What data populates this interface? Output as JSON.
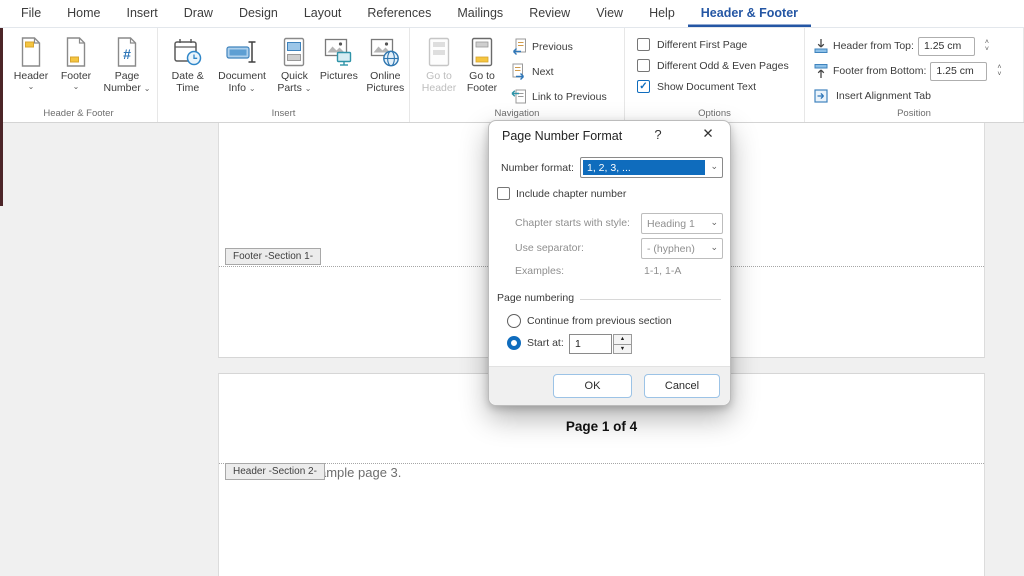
{
  "icons": {
    "close": "✕",
    "help": "?",
    "chevron_down": "⌄",
    "caret_up": "˄",
    "caret_down": "˅",
    "spin_up": "▲",
    "spin_down": "▼",
    "check": "✓"
  },
  "menu": {
    "tabs": [
      "File",
      "Home",
      "Insert",
      "Draw",
      "Design",
      "Layout",
      "References",
      "Mailings",
      "Review",
      "View",
      "Help",
      "Header & Footer"
    ],
    "active_tab": "Header & Footer"
  },
  "ribbon": {
    "header_footer_group": {
      "label": "Header & Footer",
      "header_button": "Header",
      "footer_button": "Footer",
      "page_number_button": "Page Number"
    },
    "insert_group": {
      "label": "Insert",
      "date_time_button": "Date & Time",
      "document_info_button": "Document Info",
      "quick_parts_button": "Quick Parts",
      "pictures_button": "Pictures",
      "online_pictures_button": "Online Pictures"
    },
    "navigation_group": {
      "label": "Navigation",
      "go_to_header_button": "Go to Header",
      "go_to_footer_button": "Go to Footer",
      "previous_button": "Previous",
      "next_button": "Next",
      "link_to_previous_button": "Link to Previous"
    },
    "options_group": {
      "label": "Options",
      "checkboxes": [
        {
          "label": "Different First Page",
          "checked": false
        },
        {
          "label": "Different Odd & Even Pages",
          "checked": false
        },
        {
          "label": "Show Document Text",
          "checked": true
        }
      ]
    },
    "position_group": {
      "label": "Position",
      "header_from_top_label": "Header from Top:",
      "header_from_top_value": "1.25 cm",
      "footer_from_bottom_label": "Footer from Bottom:",
      "footer_from_bottom_value": "1.25 cm",
      "insert_alignment_tab_label": "Insert Alignment Tab"
    }
  },
  "document": {
    "footer_section_tag": "Footer -Section 1-",
    "header_section_tag": "Header -Section 2-",
    "page_number_field": "Page 1 of 4",
    "body_text_visible": "ample page 3."
  },
  "dialog": {
    "title": "Page Number Format",
    "number_format_label": "Number format:",
    "number_format_value": "1, 2, 3, ...",
    "include_chapter_label": "Include chapter number",
    "chapter_style_label": "Chapter starts with style:",
    "chapter_style_value": "Heading 1",
    "separator_label": "Use separator:",
    "separator_value": "-   (hyphen)",
    "examples_label": "Examples:",
    "examples_value": "1-1, 1-A",
    "page_numbering_section": "Page numbering",
    "continue_option": "Continue from previous section",
    "start_at_label": "Start at:",
    "start_at_value": "1",
    "ok_button": "OK",
    "cancel_button": "Cancel"
  },
  "colors": {
    "accent_blue": "#0f6cbd",
    "tab_blue": "#2456a4",
    "icon_yellow": "#f5c540",
    "icon_teal": "#2e93a8"
  }
}
